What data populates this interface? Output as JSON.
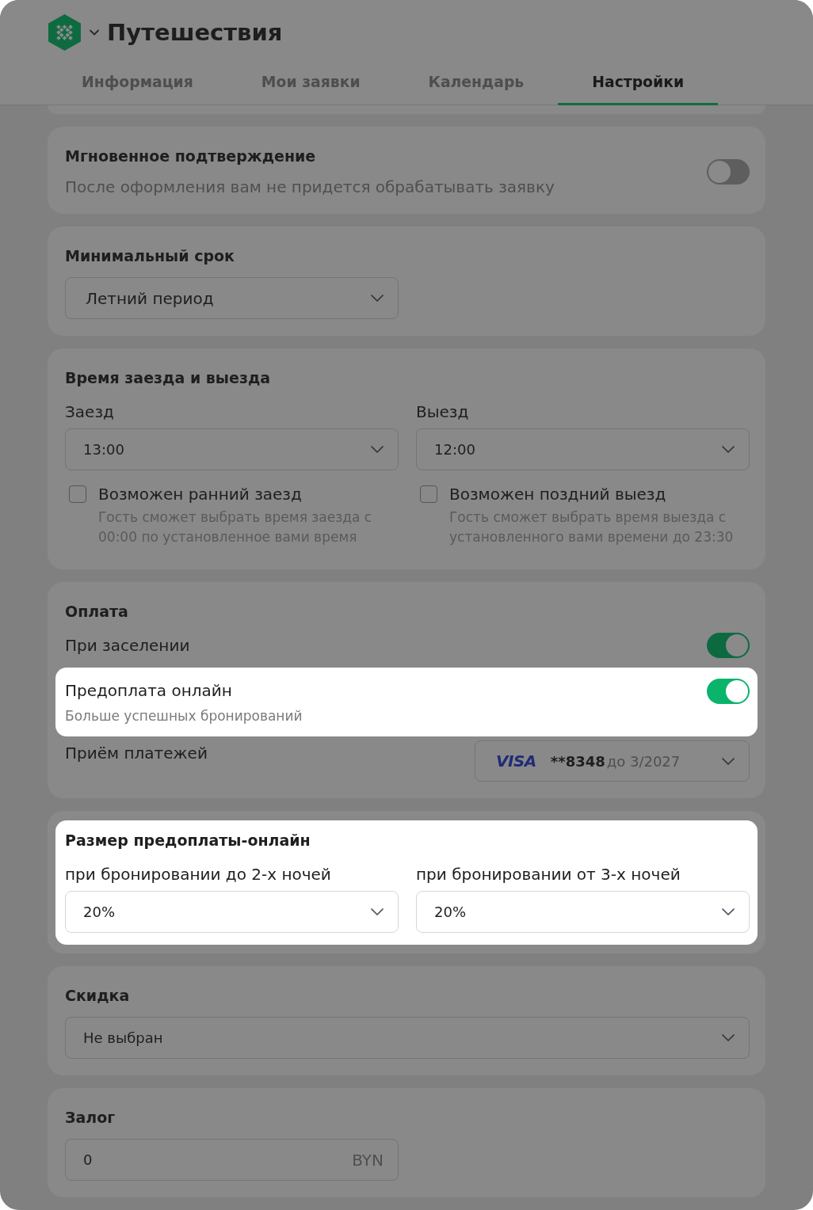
{
  "header": {
    "title": "Путешествия"
  },
  "tabs": [
    {
      "label": "Информация",
      "selected": false
    },
    {
      "label": "Мои заявки",
      "selected": false
    },
    {
      "label": "Календарь",
      "selected": false
    },
    {
      "label": "Настройки",
      "selected": true
    }
  ],
  "sections": [
    {
      "kind": "toggle",
      "highlighted": false,
      "title": "Мгновенное подтверждение",
      "description": "После оформления вам не придется обрабатывать заявку",
      "on": false
    },
    {
      "kind": "select",
      "highlighted": false,
      "title": "Минимальный срок",
      "value": "Летний период"
    },
    {
      "kind": "columns",
      "highlighted": false,
      "title": "Время заезда и выезда",
      "columns": [
        {
          "label": "Заезд",
          "value": "13:00",
          "option": {
            "label": "Возможен ранний заезд",
            "hint": "Гость сможет выбрать время заезда с 00:00 по установленное вами время",
            "checked": false
          }
        },
        {
          "label": "Выезд",
          "value": "12:00",
          "option": {
            "label": "Возможен поздний выезд",
            "hint": "Гость сможет выбрать время выезда с установленного вами времени до 23:30",
            "checked": false
          }
        }
      ]
    },
    {
      "kind": "payment",
      "highlighted": false,
      "title": "Оплата",
      "options": [
        {
          "label": "При заселении",
          "on": true,
          "highlighted": false
        },
        {
          "label": "Предоплата онлайн",
          "description": "Больше успешных бронирований",
          "on": true,
          "highlighted": true
        }
      ],
      "method": {
        "label": "Приём платежей",
        "brand": "VISA",
        "number": "**8348",
        "expiry": "до 3/2027"
      }
    },
    {
      "kind": "columns",
      "highlighted": true,
      "title": "Размер предоплаты-онлайн",
      "columns": [
        {
          "label": "при бронировании до 2-х ночей",
          "value": "20%"
        },
        {
          "label": "при бронировании от 3-х ночей",
          "value": "20%"
        }
      ]
    },
    {
      "kind": "wideselect",
      "highlighted": false,
      "title": "Скидка",
      "value": "Не выбран"
    },
    {
      "kind": "amount",
      "highlighted": false,
      "title": "Залог",
      "value": "0",
      "unit": "BYN"
    }
  ]
}
